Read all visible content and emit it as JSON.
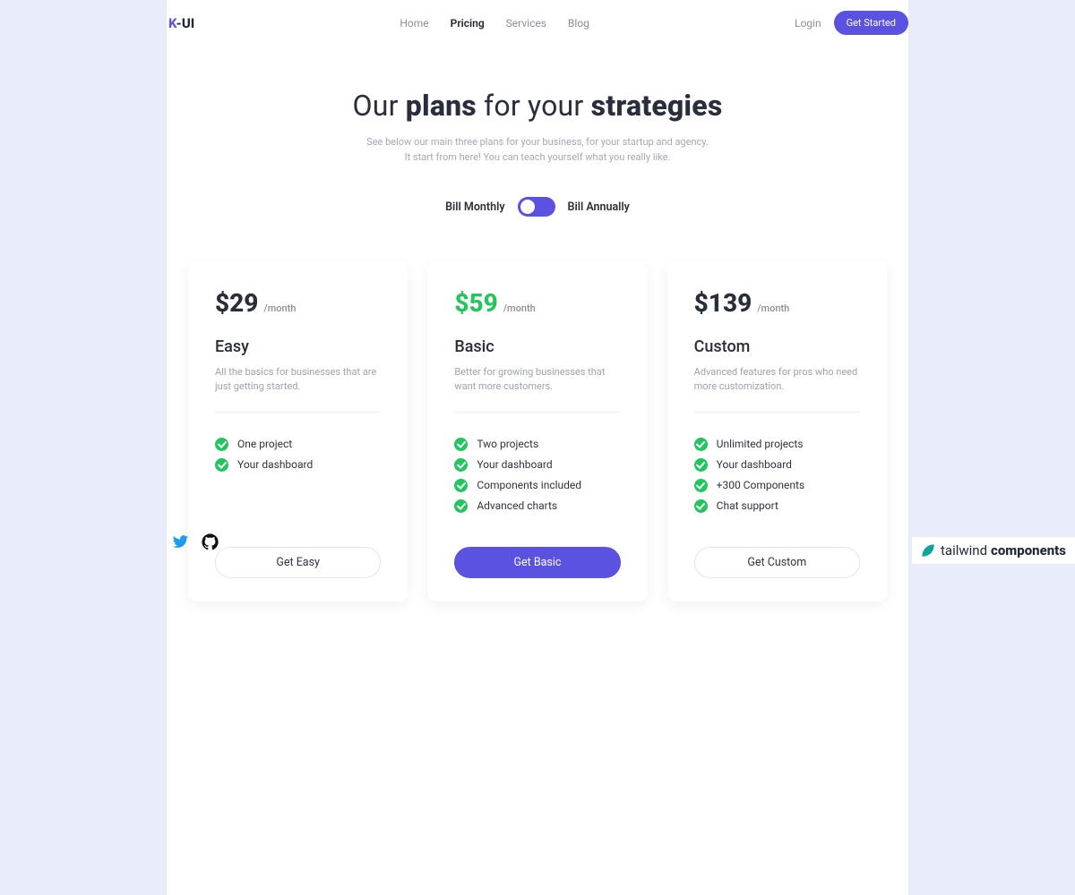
{
  "brand": {
    "k": "K",
    "rest": "-UI"
  },
  "nav": {
    "items": [
      {
        "label": "Home"
      },
      {
        "label": "Pricing"
      },
      {
        "label": "Services"
      },
      {
        "label": "Blog"
      }
    ],
    "login": "Login",
    "cta": "Get Started"
  },
  "hero": {
    "t1": "Our ",
    "t2": "plans",
    "t3": " for your ",
    "t4": "strategies",
    "sub1": "See below our main three plans for your business, for your startup and agency.",
    "sub2": "It start from here! You can teach yourself what you really like."
  },
  "toggle": {
    "left": "Bill Monthly",
    "right": "Bill Annually"
  },
  "plans": [
    {
      "price": "$29",
      "per": "/month",
      "name": "Easy",
      "desc": "All the basics for businesses that are just getting started.",
      "features": [
        "One project",
        "Your dashboard"
      ],
      "button": "Get Easy"
    },
    {
      "price": "$59",
      "per": "/month",
      "name": "Basic",
      "desc": "Better for growing businesses that want more customers.",
      "features": [
        "Two projects",
        "Your dashboard",
        "Components included",
        "Advanced charts"
      ],
      "button": "Get Basic"
    },
    {
      "price": "$139",
      "per": "/month",
      "name": "Custom",
      "desc": "Advanced features for pros who need more customization.",
      "features": [
        "Unlimited projects",
        "Your dashboard",
        "+300 Components",
        "Chat support"
      ],
      "button": "Get Custom"
    }
  ],
  "watermark": {
    "a": "tailwind",
    "b": "components"
  }
}
